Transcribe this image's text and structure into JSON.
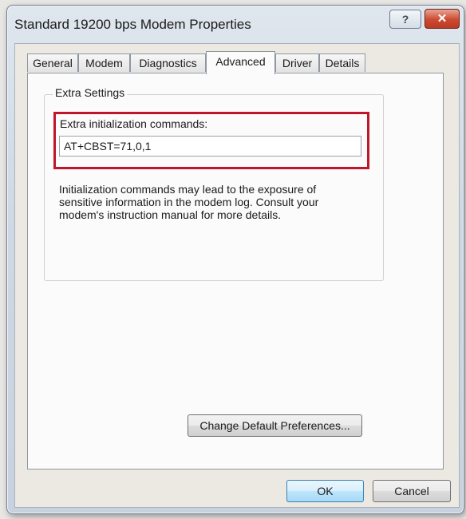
{
  "window": {
    "title": "Standard 19200 bps Modem Properties",
    "help_glyph": "?",
    "close_glyph": "✕"
  },
  "tabs": [
    {
      "label": "General"
    },
    {
      "label": "Modem"
    },
    {
      "label": "Diagnostics"
    },
    {
      "label": "Advanced"
    },
    {
      "label": "Driver"
    },
    {
      "label": "Details"
    }
  ],
  "active_tab": "Advanced",
  "extra_settings": {
    "group_label": "Extra Settings",
    "field_label": "Extra initialization commands:",
    "field_value": "AT+CBST=71,0,1",
    "info_text": "Initialization commands may lead to the exposure of sensitive information in the modem log. Consult your modem's instruction manual for more details."
  },
  "buttons": {
    "change_prefs": "Change Default Preferences...",
    "ok": "OK",
    "cancel": "Cancel"
  },
  "colors": {
    "highlight": "#c0162a",
    "close_button": "#cc4a30"
  }
}
